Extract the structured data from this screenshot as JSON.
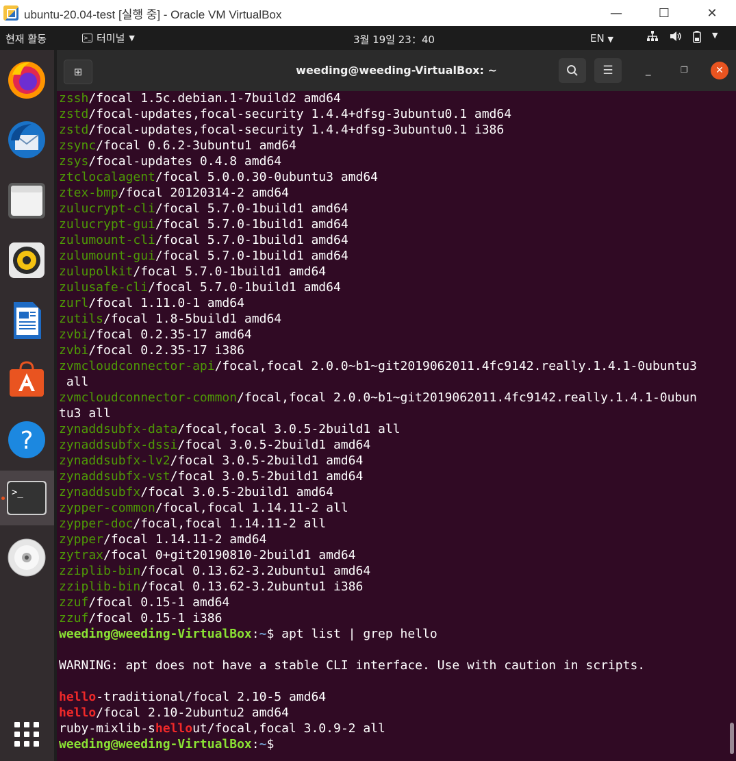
{
  "window": {
    "title": "ubuntu-20.04-test [실행 중] - Oracle VM VirtualBox",
    "minimize": "—",
    "maximize": "☐",
    "close": "✕"
  },
  "topbar": {
    "activities": "현재 활동",
    "app_menu": "터미널",
    "clock": "3월 19일 23：40",
    "lang": "EN"
  },
  "dock": {
    "items": [
      "firefox-icon",
      "thunderbird-icon",
      "files-icon",
      "rhythmbox-icon",
      "writer-icon",
      "software-icon",
      "help-icon",
      "terminal-icon",
      "dvd-icon",
      "show-apps-icon"
    ]
  },
  "terminal": {
    "title": "weeding@weeding-VirtualBox: ~",
    "prompt_user": "weeding@weeding-VirtualBox",
    "prompt_sep": ":",
    "prompt_path": "~",
    "prompt_end": "$",
    "command": " apt list | grep hello",
    "warning": "WARNING: apt does not have a stable CLI interface. Use with caution in scripts.",
    "packages": [
      {
        "name": "zssh",
        "rest": "/focal 1.5c.debian.1-7build2 amd64"
      },
      {
        "name": "zstd",
        "rest": "/focal-updates,focal-security 1.4.4+dfsg-3ubuntu0.1 amd64"
      },
      {
        "name": "zstd",
        "rest": "/focal-updates,focal-security 1.4.4+dfsg-3ubuntu0.1 i386"
      },
      {
        "name": "zsync",
        "rest": "/focal 0.6.2-3ubuntu1 amd64"
      },
      {
        "name": "zsys",
        "rest": "/focal-updates 0.4.8 amd64"
      },
      {
        "name": "ztclocalagent",
        "rest": "/focal 5.0.0.30-0ubuntu3 amd64"
      },
      {
        "name": "ztex-bmp",
        "rest": "/focal 20120314-2 amd64"
      },
      {
        "name": "zulucrypt-cli",
        "rest": "/focal 5.7.0-1build1 amd64"
      },
      {
        "name": "zulucrypt-gui",
        "rest": "/focal 5.7.0-1build1 amd64"
      },
      {
        "name": "zulumount-cli",
        "rest": "/focal 5.7.0-1build1 amd64"
      },
      {
        "name": "zulumount-gui",
        "rest": "/focal 5.7.0-1build1 amd64"
      },
      {
        "name": "zulupolkit",
        "rest": "/focal 5.7.0-1build1 amd64"
      },
      {
        "name": "zulusafe-cli",
        "rest": "/focal 5.7.0-1build1 amd64"
      },
      {
        "name": "zurl",
        "rest": "/focal 1.11.0-1 amd64"
      },
      {
        "name": "zutils",
        "rest": "/focal 1.8-5build1 amd64"
      },
      {
        "name": "zvbi",
        "rest": "/focal 0.2.35-17 amd64"
      },
      {
        "name": "zvbi",
        "rest": "/focal 0.2.35-17 i386"
      },
      {
        "name": "zvmcloudconnector-api",
        "rest": "/focal,focal 2.0.0~b1~git2019062011.4fc9142.really.1.4.1-0ubuntu3",
        "cont": " all"
      },
      {
        "name": "zvmcloudconnector-common",
        "rest": "/focal,focal 2.0.0~b1~git2019062011.4fc9142.really.1.4.1-0ubun",
        "cont": "tu3 all"
      },
      {
        "name": "zynaddsubfx-data",
        "rest": "/focal,focal 3.0.5-2build1 all"
      },
      {
        "name": "zynaddsubfx-dssi",
        "rest": "/focal 3.0.5-2build1 amd64"
      },
      {
        "name": "zynaddsubfx-lv2",
        "rest": "/focal 3.0.5-2build1 amd64"
      },
      {
        "name": "zynaddsubfx-vst",
        "rest": "/focal 3.0.5-2build1 amd64"
      },
      {
        "name": "zynaddsubfx",
        "rest": "/focal 3.0.5-2build1 amd64"
      },
      {
        "name": "zypper-common",
        "rest": "/focal,focal 1.14.11-2 all"
      },
      {
        "name": "zypper-doc",
        "rest": "/focal,focal 1.14.11-2 all"
      },
      {
        "name": "zypper",
        "rest": "/focal 1.14.11-2 amd64"
      },
      {
        "name": "zytrax",
        "rest": "/focal 0+git20190810-2build1 amd64"
      },
      {
        "name": "zziplib-bin",
        "rest": "/focal 0.13.62-3.2ubuntu1 amd64"
      },
      {
        "name": "zziplib-bin",
        "rest": "/focal 0.13.62-3.2ubuntu1 i386"
      },
      {
        "name": "zzuf",
        "rest": "/focal 0.15-1 amd64"
      },
      {
        "name": "zzuf",
        "rest": "/focal 0.15-1 i386"
      }
    ],
    "results": [
      {
        "pre": "",
        "match": "hello",
        "post": "-traditional/focal 2.10-5 amd64"
      },
      {
        "pre": "",
        "match": "hello",
        "post": "/focal 2.10-2ubuntu2 amd64"
      },
      {
        "pre": "ruby-mixlib-s",
        "match": "hello",
        "post": "ut/focal,focal 3.0.9-2 all"
      }
    ]
  }
}
